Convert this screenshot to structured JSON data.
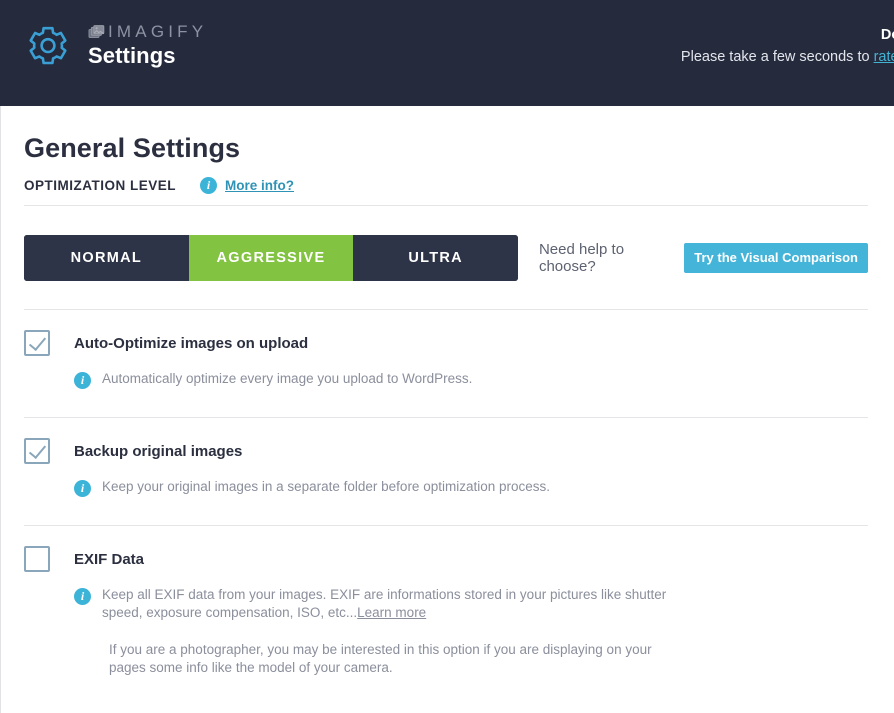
{
  "header": {
    "gear_icon": "gear-icon",
    "logo_mark_icon": "imagify-photos-logo-icon",
    "brand_name": "IMAGIFY",
    "brand_subtitle": "Settings",
    "background_color": "#252b3d",
    "notice": {
      "line1": "Do you",
      "line2_prefix": "Please take a few seconds to ",
      "line2_link": "rate it on",
      "stars": "★"
    }
  },
  "main": {
    "page_title": "General Settings",
    "section_label": "OPTIMIZATION LEVEL",
    "more_info_link": "More info?",
    "info_icon": "info-icon",
    "optimization_levels": [
      {
        "label": "NORMAL",
        "active": false
      },
      {
        "label": "AGGRESSIVE",
        "active": true
      },
      {
        "label": "ULTRA",
        "active": false
      }
    ],
    "active_level_color": "#82c341",
    "help": {
      "text": "Need help to choose?",
      "button_label": "Try the Visual Comparison",
      "button_color": "#45b4d9"
    },
    "options": [
      {
        "title": "Auto-Optimize images on upload",
        "checked": true,
        "description": "Automatically optimize every image you upload to WordPress."
      },
      {
        "title": "Backup original images",
        "checked": true,
        "description": "Keep your original images in a separate folder before optimization process."
      },
      {
        "title": "EXIF Data",
        "checked": false,
        "description": "Keep all EXIF data from your images. EXIF are informations stored in your pictures like shutter speed, exposure compensation, ISO, etc...",
        "description_link": "Learn more",
        "note": "If you are a photographer, you may be interested in this option if you are displaying on your pages some info like the model of your camera."
      }
    ]
  }
}
